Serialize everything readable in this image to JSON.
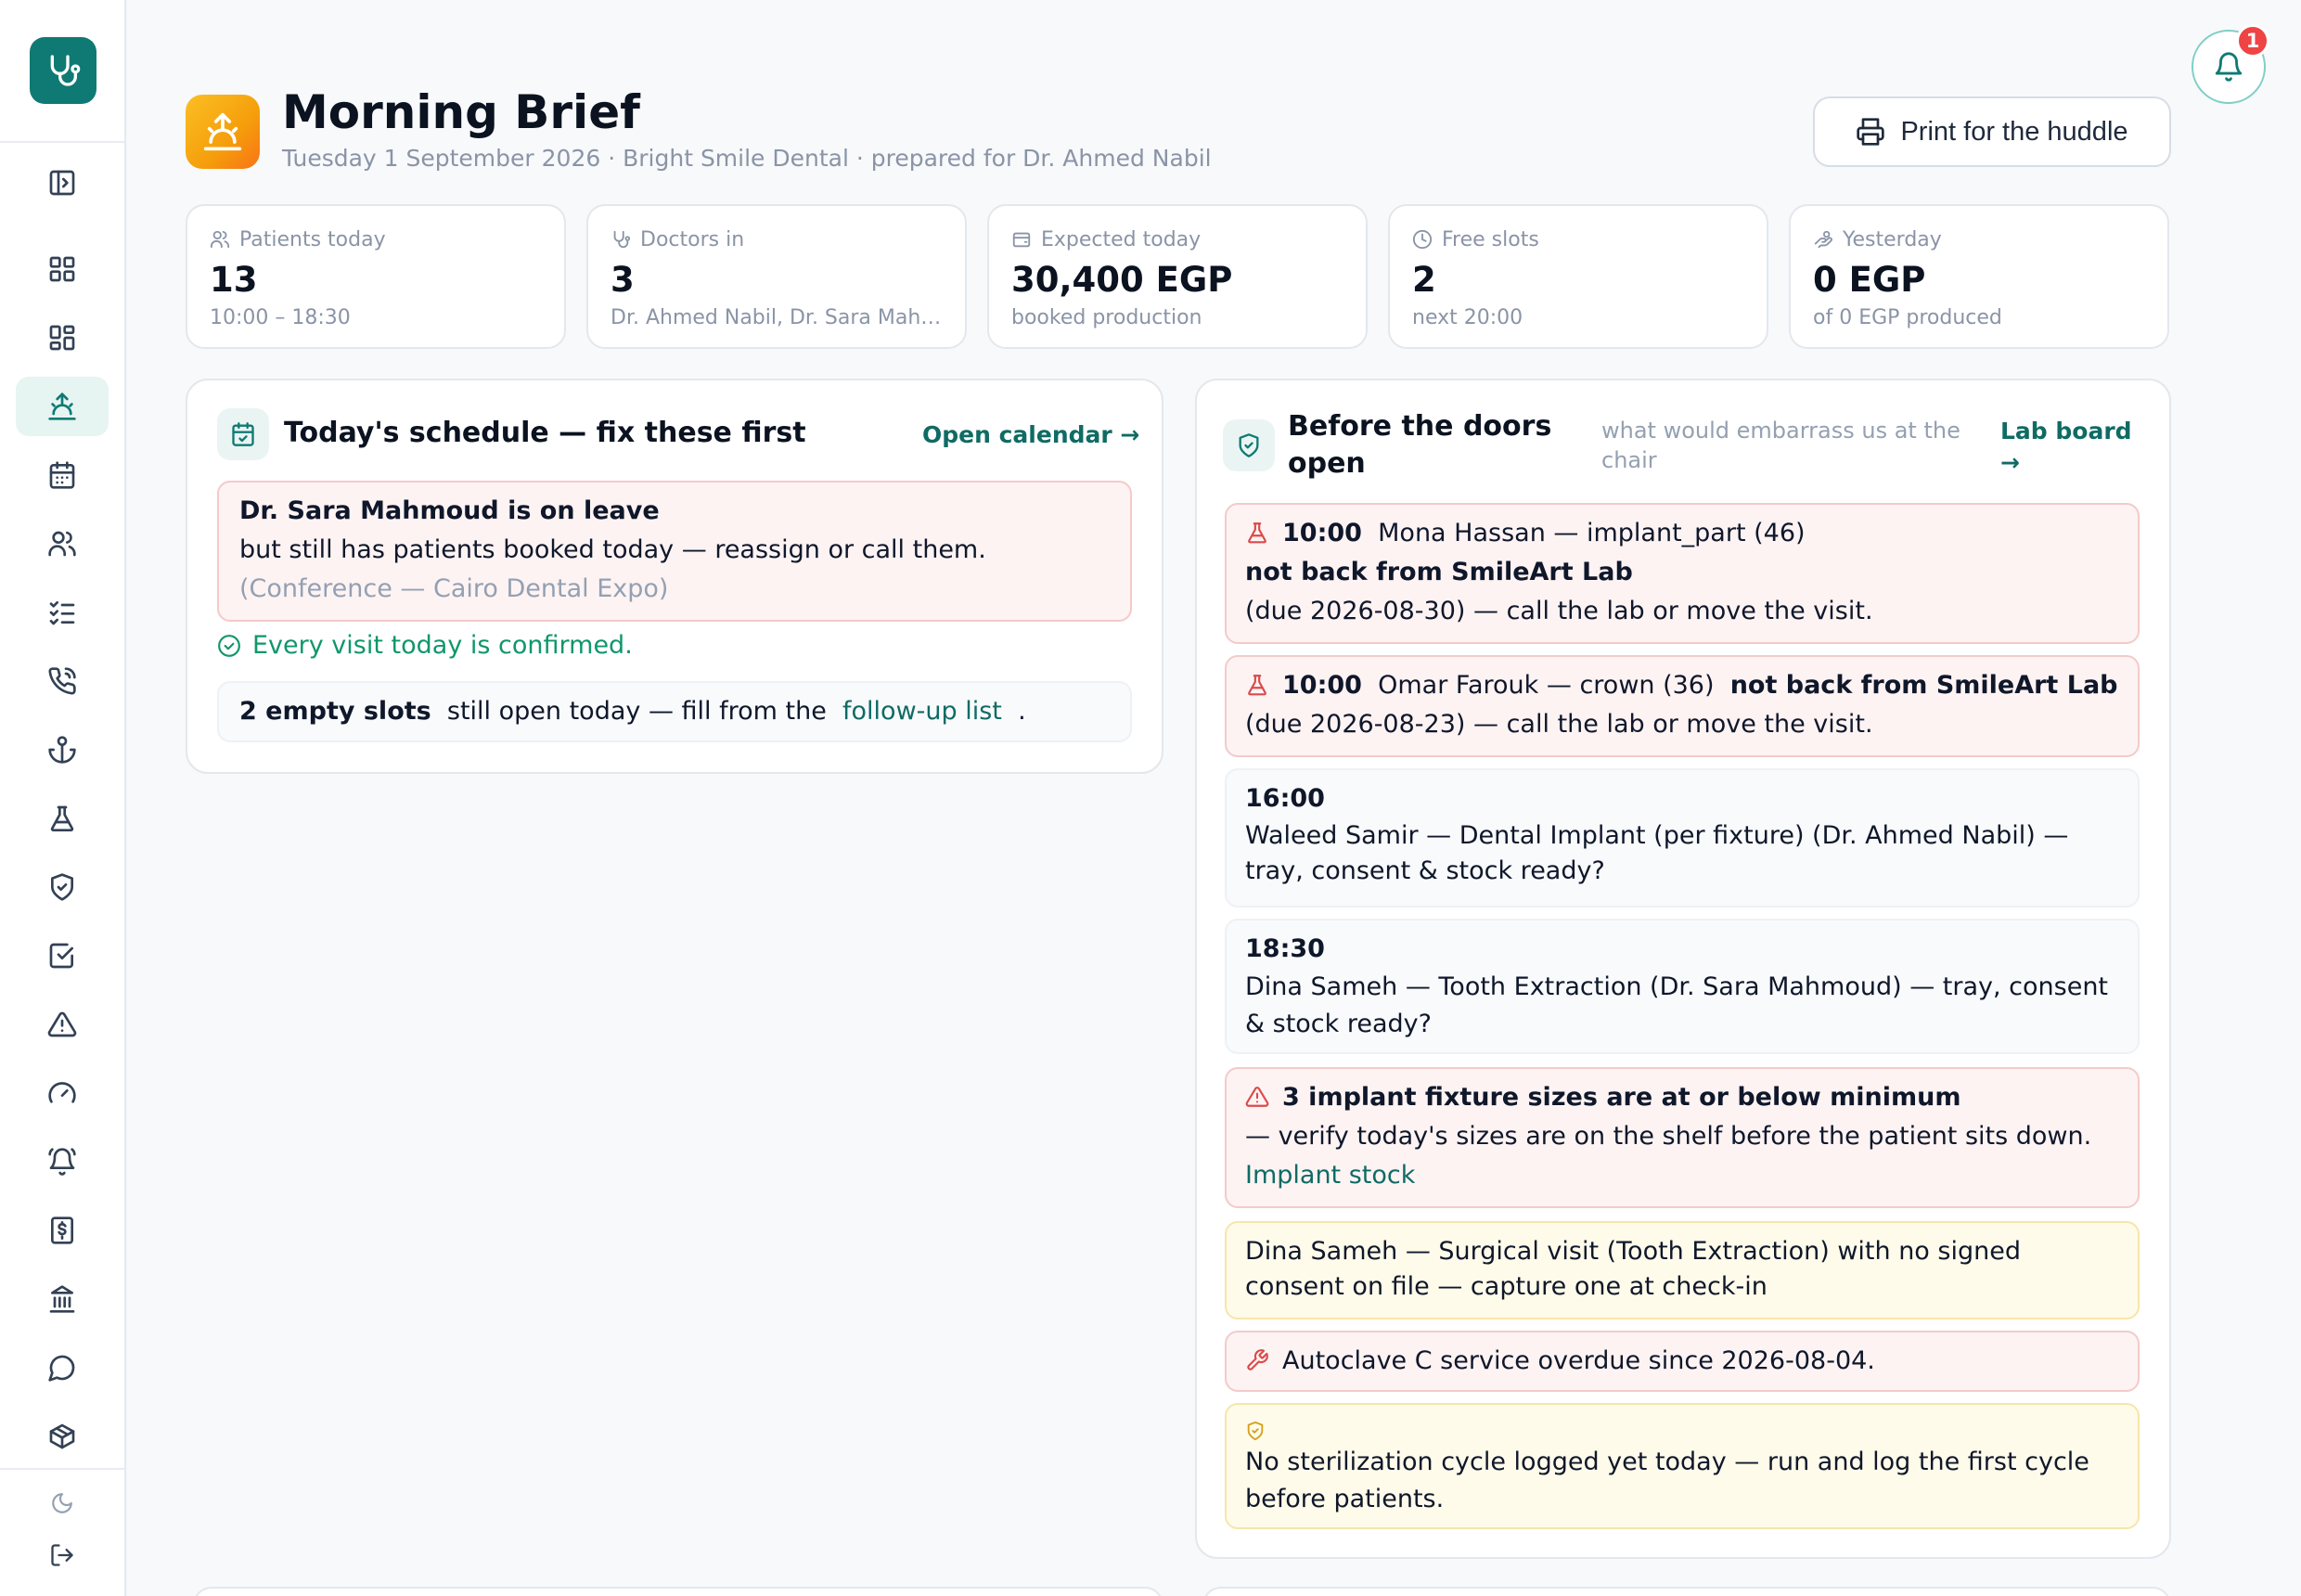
{
  "header": {
    "title": "Morning Brief",
    "subtitle": "Tuesday 1 September 2026 · Bright Smile Dental · prepared for Dr. Ahmed Nabil",
    "print_label": "Print for the huddle"
  },
  "notifications": {
    "count": "1"
  },
  "sidebar": {
    "items": [
      {
        "name": "toggle-sidebar-icon"
      },
      {
        "name": "dashboard-icon"
      },
      {
        "name": "widgets-icon"
      },
      {
        "name": "morning-brief-icon",
        "active": true
      },
      {
        "name": "calendar-icon"
      },
      {
        "name": "patients-icon"
      },
      {
        "name": "checklist-icon"
      },
      {
        "name": "phone-call-icon"
      },
      {
        "name": "anchor-icon"
      },
      {
        "name": "lab-flask-icon"
      },
      {
        "name": "shield-check-icon"
      },
      {
        "name": "tasks-icon"
      },
      {
        "name": "alert-icon"
      },
      {
        "name": "gauge-icon"
      },
      {
        "name": "bell-alarm-icon"
      },
      {
        "name": "billing-icon"
      },
      {
        "name": "bank-icon"
      },
      {
        "name": "chat-icon"
      },
      {
        "name": "inventory-box-icon"
      },
      {
        "name": "dark-mode-icon"
      },
      {
        "name": "logout-icon"
      }
    ]
  },
  "stats": [
    {
      "label": "Patients today",
      "value": "13",
      "foot": "10:00 – 18:30",
      "icon": "users-icon"
    },
    {
      "label": "Doctors in",
      "value": "3",
      "foot": "Dr. Ahmed Nabil, Dr. Sara Mah…",
      "icon": "stethoscope-icon"
    },
    {
      "label": "Expected today",
      "value": "30,400 EGP",
      "foot": "booked production",
      "icon": "wallet-icon"
    },
    {
      "label": "Free slots",
      "value": "2",
      "foot": "next 20:00",
      "icon": "clock-icon"
    },
    {
      "label": "Yesterday",
      "value": "0 EGP",
      "foot": "of 0 EGP produced",
      "icon": "money-icon"
    }
  ],
  "schedule": {
    "title": "Today's schedule — fix these first",
    "link": "Open calendar →",
    "leave": {
      "title": "Dr. Sara Mahmoud is on leave",
      "text": "but still has patients booked today — reassign or call them.",
      "note": "(Conference — Cairo Dental Expo)"
    },
    "confirmed": "Every visit today is confirmed.",
    "slots": {
      "count": "2 empty slots",
      "text": "still open today — fill from the",
      "link": "follow-up list",
      "end": "."
    }
  },
  "doors": {
    "title": "Before the doors open",
    "note": "what would embarrass us at the chair",
    "link": "Lab board →",
    "items": [
      {
        "time": "10:00",
        "who": "Mona Hassan — implant_part (46)",
        "issue": "not back from SmileArt Lab",
        "detail": "(due 2026-08-30) — call the lab or move the visit."
      },
      {
        "time": "10:00",
        "who": "Omar Farouk — crown (36)",
        "issue": "not back from SmileArt Lab",
        "detail": "(due 2026-08-23) — call the lab or move the visit."
      },
      {
        "time": "16:00",
        "detail": "Waleed Samir — Dental Implant (per fixture) (Dr. Ahmed Nabil) — tray, consent & stock ready?"
      },
      {
        "time": "18:30",
        "detail": "Dina Sameh — Tooth Extraction (Dr. Sara Mahmoud) — tray, consent & stock ready?"
      },
      {
        "title": "3 implant fixture sizes are at or below minimum",
        "detail": "— verify today's sizes are on the shelf before the patient sits down.",
        "link": "Implant stock"
      },
      {
        "detail": "Dina Sameh — Surgical visit (Tooth Extraction) with no signed consent on file — capture one at check-in"
      },
      {
        "detail": "Autoclave C service overdue since 2026-08-04."
      },
      {
        "detail": "No sterilization cycle logged yet today — run and log the first cycle before patients."
      }
    ]
  },
  "colors": {
    "brand": "#0f7a73",
    "danger_bg": "#fdf3f3",
    "warning_bg": "#fffbea",
    "success": "#10966b"
  }
}
